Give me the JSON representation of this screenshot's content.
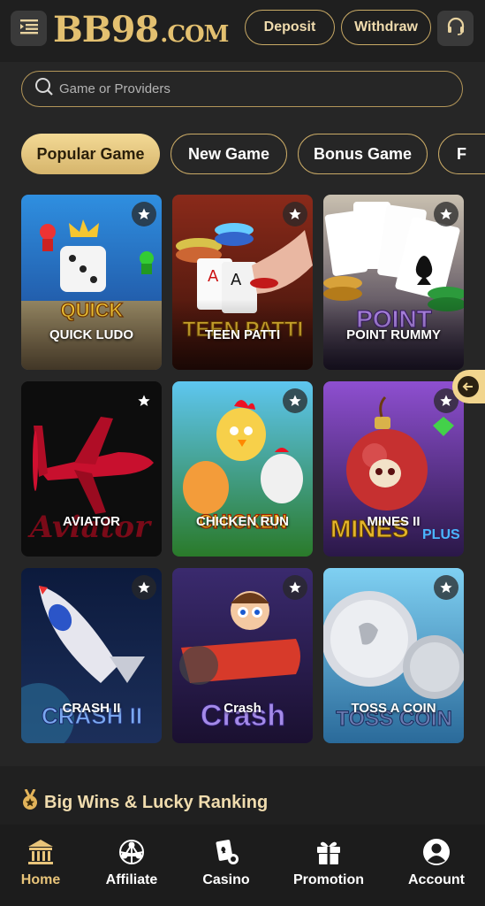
{
  "header": {
    "logo_main": "BB98",
    "logo_suffix": ".COM",
    "deposit_label": "Deposit",
    "withdraw_label": "Withdraw"
  },
  "search": {
    "placeholder": "Game or Providers"
  },
  "tabs": [
    {
      "label": "Popular Game",
      "active": true
    },
    {
      "label": "New Game"
    },
    {
      "label": "Bonus Game"
    },
    {
      "label": "F"
    }
  ],
  "games": [
    {
      "title": "QUICK LUDO"
    },
    {
      "title": "TEEN PATTI"
    },
    {
      "title": "POINT RUMMY"
    },
    {
      "title": "AVIATOR"
    },
    {
      "title": "CHICKEN RUN"
    },
    {
      "title": "MINES II"
    },
    {
      "title": "CRASH II"
    },
    {
      "title": "Crash"
    },
    {
      "title": "TOSS A COIN"
    }
  ],
  "ranking": {
    "title": "Big Wins & Lucky Ranking"
  },
  "nav": [
    {
      "label": "Home",
      "icon": "bank-icon",
      "active": true
    },
    {
      "label": "Affiliate",
      "icon": "network-icon"
    },
    {
      "label": "Casino",
      "icon": "cards-icon"
    },
    {
      "label": "Promotion",
      "icon": "gift-icon"
    },
    {
      "label": "Account",
      "icon": "user-icon"
    }
  ],
  "colors": {
    "accent": "#e3c070",
    "background": "#262626"
  }
}
